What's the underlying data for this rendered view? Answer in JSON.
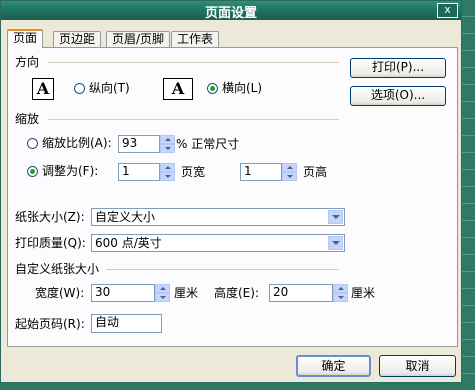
{
  "window": {
    "title": "页面设置",
    "close_label": "x"
  },
  "tabs": [
    {
      "label": "页面",
      "active": true
    },
    {
      "label": "页边距",
      "active": false
    },
    {
      "label": "页眉/页脚",
      "active": false
    },
    {
      "label": "工作表",
      "active": false
    }
  ],
  "orientation": {
    "section_label": "方向",
    "page_glyph": "A",
    "portrait_label": "纵向(T)",
    "landscape_label": "横向(L)",
    "selected": "landscape"
  },
  "scaling": {
    "section_label": "缩放",
    "adjust_label": "缩放比例(A):",
    "adjust_value": "93",
    "adjust_suffix": "% 正常尺寸",
    "fit_label": "调整为(F):",
    "fit_wide_value": "1",
    "fit_wide_suffix": "页宽",
    "fit_tall_value": "1",
    "fit_tall_suffix": "页高",
    "selected": "fit"
  },
  "paper": {
    "size_label": "纸张大小(Z):",
    "size_value": "自定义大小",
    "quality_label": "打印质量(Q):",
    "quality_value": "600 点/英寸"
  },
  "custom_size": {
    "section_label": "自定义纸张大小",
    "width_label": "宽度(W):",
    "width_value": "30",
    "width_unit": "厘米",
    "height_label": "高度(E):",
    "height_value": "20",
    "height_unit": "厘米"
  },
  "first_page": {
    "label": "起始页码(R):",
    "value": "自动"
  },
  "buttons": {
    "print": "打印(P)...",
    "options": "选项(O)...",
    "ok": "确定",
    "cancel": "取消"
  }
}
